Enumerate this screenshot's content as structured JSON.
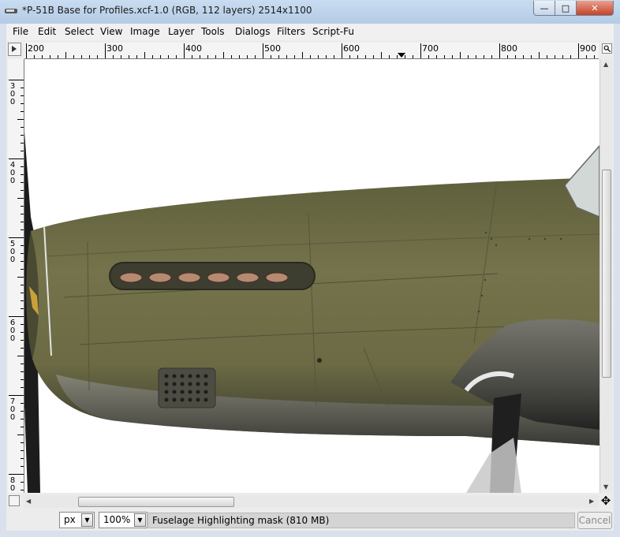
{
  "window": {
    "title": "*P-51B Base for Profiles.xcf-1.0 (RGB, 112 layers) 2514x1100",
    "minimize_glyph": "—",
    "maximize_glyph": "□",
    "close_glyph": "✕"
  },
  "menu": [
    "File",
    "Edit",
    "Select",
    "View",
    "Image",
    "Layer",
    "Tools",
    "Dialogs",
    "Filters",
    "Script-Fu"
  ],
  "horizontal_ruler": [
    "200",
    "300",
    "400",
    "500",
    "600",
    "700",
    "800",
    "900"
  ],
  "vertical_ruler": [
    "300",
    "400",
    "500",
    "600",
    "700",
    "800"
  ],
  "status": {
    "unit": "px",
    "zoom": "100%",
    "message": "Fuselage Highlighting mask (810 MB)",
    "cancel_label": "Cancel"
  },
  "icons": {
    "menu_toggle": "triangle-right-icon",
    "navigate": "magnifier-icon",
    "quick_mask": "quick-mask-icon",
    "move": "four-arrow-move-icon"
  },
  "colors": {
    "fuselage": "#6e6d45",
    "window_frame": "#d8e1ec",
    "close_button": "#c5432a"
  }
}
